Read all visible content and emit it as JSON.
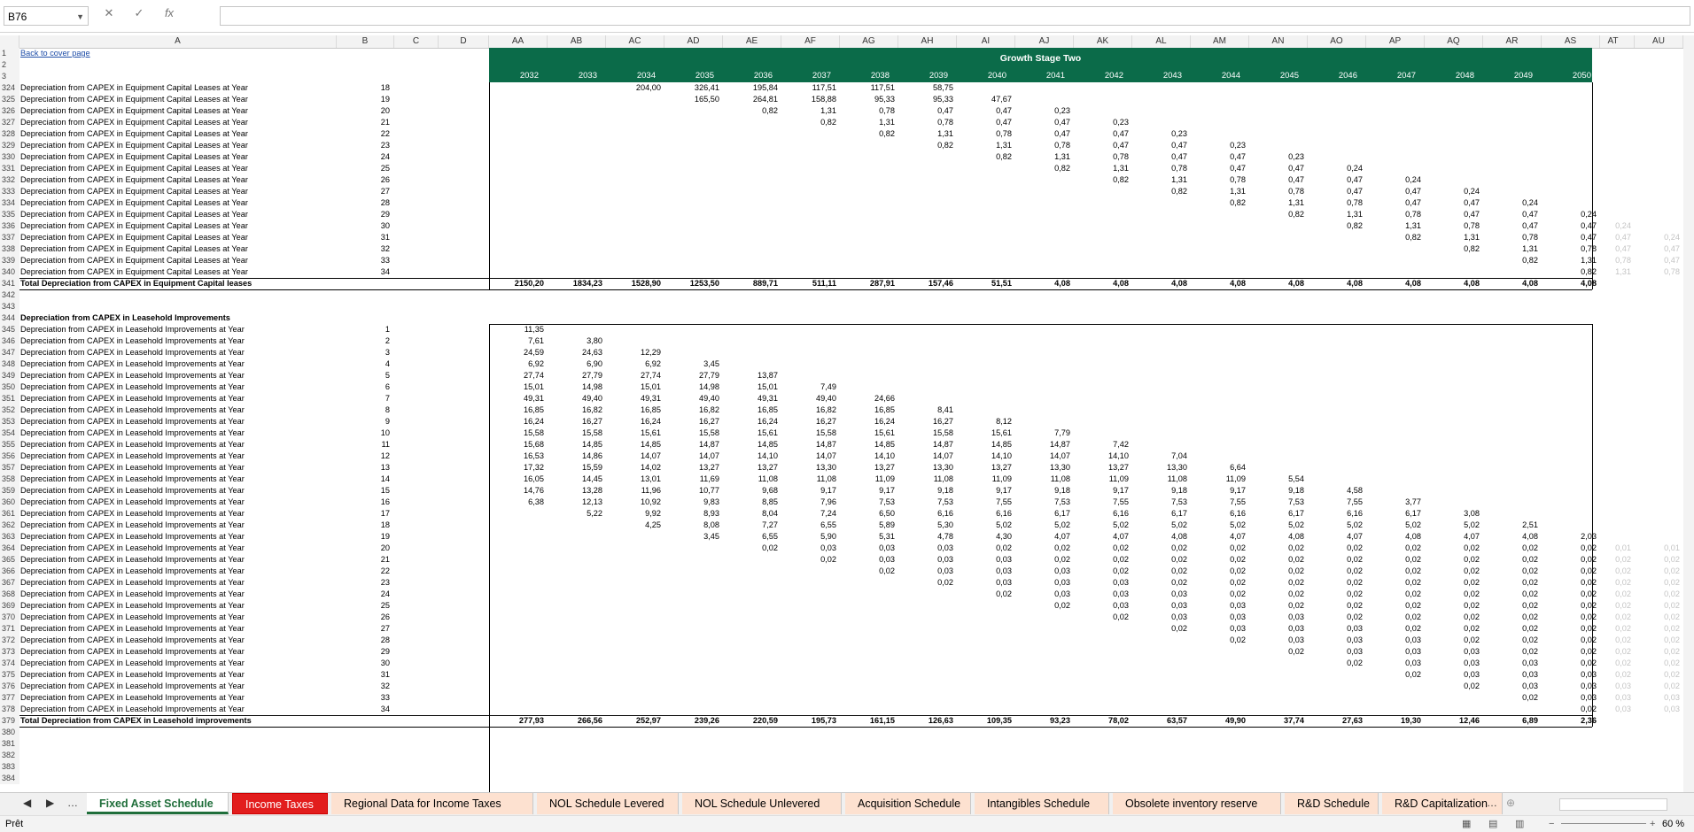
{
  "namebox": {
    "value": "B76"
  },
  "columns": [
    "A",
    "B",
    "C",
    "D",
    "AA",
    "AB",
    "AC",
    "AD",
    "AE",
    "AF",
    "AG",
    "AH",
    "AI",
    "AJ",
    "AK",
    "AL",
    "AM",
    "AN",
    "AO",
    "AP",
    "AQ",
    "AR",
    "AS",
    "AT",
    "AU"
  ],
  "growth_stage_title": "Growth Stage Two",
  "years": [
    "2032",
    "2033",
    "2034",
    "2035",
    "2036",
    "2037",
    "2038",
    "2039",
    "2040",
    "2041",
    "2042",
    "2043",
    "2044",
    "2045",
    "2046",
    "2047",
    "2048",
    "2049",
    "2050"
  ],
  "back_link": "Back to cover page",
  "equip_label": "Depreciation from CAPEX in Equipment Capital Leases at Year",
  "lease_label": "Depreciation from CAPEX in Leasehold Improvements at Year",
  "equip_rows": [
    {
      "r": "324",
      "b": "18",
      "v": {
        "AC": "204,00",
        "AD": "326,41",
        "AE": "195,84",
        "AF": "117,51",
        "AG": "117,51",
        "AH": "58,75"
      }
    },
    {
      "r": "325",
      "b": "19",
      "v": {
        "AD": "165,50",
        "AE": "264,81",
        "AF": "158,88",
        "AG": "95,33",
        "AH": "95,33",
        "AI": "47,67"
      }
    },
    {
      "r": "326",
      "b": "20",
      "v": {
        "AE": "0,82",
        "AF": "1,31",
        "AG": "0,78",
        "AH": "0,47",
        "AI": "0,47",
        "AJ": "0,23"
      }
    },
    {
      "r": "327",
      "b": "21",
      "v": {
        "AF": "0,82",
        "AG": "1,31",
        "AH": "0,78",
        "AI": "0,47",
        "AJ": "0,47",
        "AK": "0,23"
      }
    },
    {
      "r": "328",
      "b": "22",
      "v": {
        "AG": "0,82",
        "AH": "1,31",
        "AI": "0,78",
        "AJ": "0,47",
        "AK": "0,47",
        "AL": "0,23"
      }
    },
    {
      "r": "329",
      "b": "23",
      "v": {
        "AH": "0,82",
        "AI": "1,31",
        "AJ": "0,78",
        "AK": "0,47",
        "AL": "0,47",
        "AM": "0,23"
      }
    },
    {
      "r": "330",
      "b": "24",
      "v": {
        "AI": "0,82",
        "AJ": "1,31",
        "AK": "0,78",
        "AL": "0,47",
        "AM": "0,47",
        "AN": "0,23"
      }
    },
    {
      "r": "331",
      "b": "25",
      "v": {
        "AJ": "0,82",
        "AK": "1,31",
        "AL": "0,78",
        "AM": "0,47",
        "AN": "0,47",
        "AO": "0,24"
      }
    },
    {
      "r": "332",
      "b": "26",
      "v": {
        "AK": "0,82",
        "AL": "1,31",
        "AM": "0,78",
        "AN": "0,47",
        "AO": "0,47",
        "AP": "0,24"
      }
    },
    {
      "r": "333",
      "b": "27",
      "v": {
        "AL": "0,82",
        "AM": "1,31",
        "AN": "0,78",
        "AO": "0,47",
        "AP": "0,47",
        "AQ": "0,24"
      }
    },
    {
      "r": "334",
      "b": "28",
      "v": {
        "AM": "0,82",
        "AN": "1,31",
        "AO": "0,78",
        "AP": "0,47",
        "AQ": "0,47",
        "AR": "0,24"
      }
    },
    {
      "r": "335",
      "b": "29",
      "v": {
        "AN": "0,82",
        "AO": "1,31",
        "AP": "0,78",
        "AQ": "0,47",
        "AR": "0,47",
        "AS": "0,24"
      }
    },
    {
      "r": "336",
      "b": "30",
      "v": {
        "AO": "0,82",
        "AP": "1,31",
        "AQ": "0,78",
        "AR": "0,47",
        "AS": "0,47",
        "AT": "0,24"
      }
    },
    {
      "r": "337",
      "b": "31",
      "v": {
        "AP": "0,82",
        "AQ": "1,31",
        "AR": "0,78",
        "AS": "0,47",
        "AT": "0,47",
        "AU": "0,24"
      }
    },
    {
      "r": "338",
      "b": "32",
      "v": {
        "AQ": "0,82",
        "AR": "1,31",
        "AS": "0,78",
        "AT": "0,47",
        "AU": "0,47"
      }
    },
    {
      "r": "339",
      "b": "33",
      "v": {
        "AR": "0,82",
        "AS": "1,31",
        "AT": "0,78",
        "AU": "0,47"
      }
    },
    {
      "r": "340",
      "b": "34",
      "v": {
        "AS": "0,82",
        "AT": "1,31",
        "AU": "0,78"
      }
    }
  ],
  "equip_total": {
    "r": "341",
    "label": "Total Depreciation from CAPEX in Equipment Capital leases",
    "values": [
      "2150,20",
      "1834,23",
      "1528,90",
      "1253,50",
      "889,71",
      "511,11",
      "287,91",
      "157,46",
      "51,51",
      "4,08",
      "4,08",
      "4,08",
      "4,08",
      "4,08",
      "4,08",
      "4,08",
      "4,08",
      "4,08",
      "4,08"
    ]
  },
  "blank_rows_a": [
    "342",
    "343"
  ],
  "lease_header": {
    "r": "344",
    "label": "Depreciation from CAPEX in Leasehold Improvements"
  },
  "lease_rows": [
    {
      "r": "345",
      "b": "1",
      "v": {
        "AA": "11,35"
      }
    },
    {
      "r": "346",
      "b": "2",
      "v": {
        "AA": "7,61",
        "AB": "3,80"
      }
    },
    {
      "r": "347",
      "b": "3",
      "v": {
        "AA": "24,59",
        "AB": "24,63",
        "AC": "12,29"
      }
    },
    {
      "r": "348",
      "b": "4",
      "v": {
        "AA": "6,92",
        "AB": "6,90",
        "AC": "6,92",
        "AD": "3,45"
      }
    },
    {
      "r": "349",
      "b": "5",
      "v": {
        "AA": "27,74",
        "AB": "27,79",
        "AC": "27,74",
        "AD": "27,79",
        "AE": "13,87"
      }
    },
    {
      "r": "350",
      "b": "6",
      "v": {
        "AA": "15,01",
        "AB": "14,98",
        "AC": "15,01",
        "AD": "14,98",
        "AE": "15,01",
        "AF": "7,49"
      }
    },
    {
      "r": "351",
      "b": "7",
      "v": {
        "AA": "49,31",
        "AB": "49,40",
        "AC": "49,31",
        "AD": "49,40",
        "AE": "49,31",
        "AF": "49,40",
        "AG": "24,66"
      }
    },
    {
      "r": "352",
      "b": "8",
      "v": {
        "AA": "16,85",
        "AB": "16,82",
        "AC": "16,85",
        "AD": "16,82",
        "AE": "16,85",
        "AF": "16,82",
        "AG": "16,85",
        "AH": "8,41"
      }
    },
    {
      "r": "353",
      "b": "9",
      "v": {
        "AA": "16,24",
        "AB": "16,27",
        "AC": "16,24",
        "AD": "16,27",
        "AE": "16,24",
        "AF": "16,27",
        "AG": "16,24",
        "AH": "16,27",
        "AI": "8,12"
      }
    },
    {
      "r": "354",
      "b": "10",
      "v": {
        "AA": "15,58",
        "AB": "15,58",
        "AC": "15,61",
        "AD": "15,58",
        "AE": "15,61",
        "AF": "15,58",
        "AG": "15,61",
        "AH": "15,58",
        "AI": "15,61",
        "AJ": "7,79"
      }
    },
    {
      "r": "355",
      "b": "11",
      "v": {
        "AA": "15,68",
        "AB": "14,85",
        "AC": "14,85",
        "AD": "14,87",
        "AE": "14,85",
        "AF": "14,87",
        "AG": "14,85",
        "AH": "14,87",
        "AI": "14,85",
        "AJ": "14,87",
        "AK": "7,42"
      }
    },
    {
      "r": "356",
      "b": "12",
      "v": {
        "AA": "16,53",
        "AB": "14,86",
        "AC": "14,07",
        "AD": "14,07",
        "AE": "14,10",
        "AF": "14,07",
        "AG": "14,10",
        "AH": "14,07",
        "AI": "14,10",
        "AJ": "14,07",
        "AK": "14,10",
        "AL": "7,04"
      }
    },
    {
      "r": "357",
      "b": "13",
      "v": {
        "AA": "17,32",
        "AB": "15,59",
        "AC": "14,02",
        "AD": "13,27",
        "AE": "13,27",
        "AF": "13,30",
        "AG": "13,27",
        "AH": "13,30",
        "AI": "13,27",
        "AJ": "13,30",
        "AK": "13,27",
        "AL": "13,30",
        "AM": "6,64"
      }
    },
    {
      "r": "358",
      "b": "14",
      "v": {
        "AA": "16,05",
        "AB": "14,45",
        "AC": "13,01",
        "AD": "11,69",
        "AE": "11,08",
        "AF": "11,08",
        "AG": "11,09",
        "AH": "11,08",
        "AI": "11,09",
        "AJ": "11,08",
        "AK": "11,09",
        "AL": "11,08",
        "AM": "11,09",
        "AN": "5,54"
      }
    },
    {
      "r": "359",
      "b": "15",
      "v": {
        "AA": "14,76",
        "AB": "13,28",
        "AC": "11,96",
        "AD": "10,77",
        "AE": "9,68",
        "AF": "9,17",
        "AG": "9,17",
        "AH": "9,18",
        "AI": "9,17",
        "AJ": "9,18",
        "AK": "9,17",
        "AL": "9,18",
        "AM": "9,17",
        "AN": "9,18",
        "AO": "4,58"
      }
    },
    {
      "r": "360",
      "b": "16",
      "v": {
        "AA": "6,38",
        "AB": "12,13",
        "AC": "10,92",
        "AD": "9,83",
        "AE": "8,85",
        "AF": "7,96",
        "AG": "7,53",
        "AH": "7,53",
        "AI": "7,55",
        "AJ": "7,53",
        "AK": "7,55",
        "AL": "7,53",
        "AM": "7,55",
        "AN": "7,53",
        "AO": "7,55",
        "AP": "3,77"
      }
    },
    {
      "r": "361",
      "b": "17",
      "v": {
        "AB": "5,22",
        "AC": "9,92",
        "AD": "8,93",
        "AE": "8,04",
        "AF": "7,24",
        "AG": "6,50",
        "AH": "6,16",
        "AI": "6,16",
        "AJ": "6,17",
        "AK": "6,16",
        "AL": "6,17",
        "AM": "6,16",
        "AN": "6,17",
        "AO": "6,16",
        "AP": "6,17",
        "AQ": "3,08"
      }
    },
    {
      "r": "362",
      "b": "18",
      "v": {
        "AC": "4,25",
        "AD": "8,08",
        "AE": "7,27",
        "AF": "6,55",
        "AG": "5,89",
        "AH": "5,30",
        "AI": "5,02",
        "AJ": "5,02",
        "AK": "5,02",
        "AL": "5,02",
        "AM": "5,02",
        "AN": "5,02",
        "AO": "5,02",
        "AP": "5,02",
        "AQ": "5,02",
        "AR": "2,51"
      }
    },
    {
      "r": "363",
      "b": "19",
      "v": {
        "AD": "3,45",
        "AE": "6,55",
        "AF": "5,90",
        "AG": "5,31",
        "AH": "4,78",
        "AI": "4,30",
        "AJ": "4,07",
        "AK": "4,07",
        "AL": "4,08",
        "AM": "4,07",
        "AN": "4,08",
        "AO": "4,07",
        "AP": "4,08",
        "AQ": "4,07",
        "AR": "4,08",
        "AS": "2,03"
      }
    },
    {
      "r": "364",
      "b": "20",
      "v": {
        "AE": "0,02",
        "AF": "0,03",
        "AG": "0,03",
        "AH": "0,03",
        "AI": "0,02",
        "AJ": "0,02",
        "AK": "0,02",
        "AL": "0,02",
        "AM": "0,02",
        "AN": "0,02",
        "AO": "0,02",
        "AP": "0,02",
        "AQ": "0,02",
        "AR": "0,02",
        "AS": "0,02",
        "AT": "0,01",
        "AU": "0,01"
      }
    },
    {
      "r": "365",
      "b": "21",
      "v": {
        "AF": "0,02",
        "AG": "0,03",
        "AH": "0,03",
        "AI": "0,03",
        "AJ": "0,02",
        "AK": "0,02",
        "AL": "0,02",
        "AM": "0,02",
        "AN": "0,02",
        "AO": "0,02",
        "AP": "0,02",
        "AQ": "0,02",
        "AR": "0,02",
        "AS": "0,02",
        "AT": "0,02",
        "AU": "0,02"
      }
    },
    {
      "r": "366",
      "b": "22",
      "v": {
        "AG": "0,02",
        "AH": "0,03",
        "AI": "0,03",
        "AJ": "0,03",
        "AK": "0,02",
        "AL": "0,02",
        "AM": "0,02",
        "AN": "0,02",
        "AO": "0,02",
        "AP": "0,02",
        "AQ": "0,02",
        "AR": "0,02",
        "AS": "0,02",
        "AT": "0,02",
        "AU": "0,02"
      }
    },
    {
      "r": "367",
      "b": "23",
      "v": {
        "AH": "0,02",
        "AI": "0,03",
        "AJ": "0,03",
        "AK": "0,03",
        "AL": "0,02",
        "AM": "0,02",
        "AN": "0,02",
        "AO": "0,02",
        "AP": "0,02",
        "AQ": "0,02",
        "AR": "0,02",
        "AS": "0,02",
        "AT": "0,02",
        "AU": "0,02"
      }
    },
    {
      "r": "368",
      "b": "24",
      "v": {
        "AI": "0,02",
        "AJ": "0,03",
        "AK": "0,03",
        "AL": "0,03",
        "AM": "0,02",
        "AN": "0,02",
        "AO": "0,02",
        "AP": "0,02",
        "AQ": "0,02",
        "AR": "0,02",
        "AS": "0,02",
        "AT": "0,02",
        "AU": "0,02"
      }
    },
    {
      "r": "369",
      "b": "25",
      "v": {
        "AJ": "0,02",
        "AK": "0,03",
        "AL": "0,03",
        "AM": "0,03",
        "AN": "0,02",
        "AO": "0,02",
        "AP": "0,02",
        "AQ": "0,02",
        "AR": "0,02",
        "AS": "0,02",
        "AT": "0,02",
        "AU": "0,02"
      }
    },
    {
      "r": "370",
      "b": "26",
      "v": {
        "AK": "0,02",
        "AL": "0,03",
        "AM": "0,03",
        "AN": "0,03",
        "AO": "0,02",
        "AP": "0,02",
        "AQ": "0,02",
        "AR": "0,02",
        "AS": "0,02",
        "AT": "0,02",
        "AU": "0,02"
      }
    },
    {
      "r": "371",
      "b": "27",
      "v": {
        "AL": "0,02",
        "AM": "0,03",
        "AN": "0,03",
        "AO": "0,03",
        "AP": "0,02",
        "AQ": "0,02",
        "AR": "0,02",
        "AS": "0,02",
        "AT": "0,02",
        "AU": "0,02"
      }
    },
    {
      "r": "372",
      "b": "28",
      "v": {
        "AM": "0,02",
        "AN": "0,03",
        "AO": "0,03",
        "AP": "0,03",
        "AQ": "0,02",
        "AR": "0,02",
        "AS": "0,02",
        "AT": "0,02",
        "AU": "0,02"
      }
    },
    {
      "r": "373",
      "b": "29",
      "v": {
        "AN": "0,02",
        "AO": "0,03",
        "AP": "0,03",
        "AQ": "0,03",
        "AR": "0,02",
        "AS": "0,02",
        "AT": "0,02",
        "AU": "0,02"
      }
    },
    {
      "r": "374",
      "b": "30",
      "v": {
        "AO": "0,02",
        "AP": "0,03",
        "AQ": "0,03",
        "AR": "0,03",
        "AS": "0,02",
        "AT": "0,02",
        "AU": "0,02"
      }
    },
    {
      "r": "375",
      "b": "31",
      "v": {
        "AP": "0,02",
        "AQ": "0,03",
        "AR": "0,03",
        "AS": "0,03",
        "AT": "0,02",
        "AU": "0,02"
      }
    },
    {
      "r": "376",
      "b": "32",
      "v": {
        "AQ": "0,02",
        "AR": "0,03",
        "AS": "0,03",
        "AT": "0,03",
        "AU": "0,02"
      }
    },
    {
      "r": "377",
      "b": "33",
      "v": {
        "AR": "0,02",
        "AS": "0,03",
        "AT": "0,03",
        "AU": "0,03"
      }
    },
    {
      "r": "378",
      "b": "34",
      "v": {
        "AS": "0,02",
        "AT": "0,03",
        "AU": "0,03"
      }
    }
  ],
  "lease_total": {
    "r": "379",
    "label": "Total Depreciation from CAPEX in Leasehold improvements",
    "values": [
      "277,93",
      "266,56",
      "252,97",
      "239,26",
      "220,59",
      "195,73",
      "161,15",
      "126,63",
      "109,35",
      "93,23",
      "78,02",
      "63,57",
      "49,90",
      "37,74",
      "27,63",
      "19,30",
      "12,46",
      "6,89",
      "2,36"
    ]
  },
  "blank_rows_b": [
    "380",
    "381",
    "382",
    "383",
    "384"
  ],
  "tabs": [
    {
      "label": "Fixed Asset Schedule",
      "style": "active"
    },
    {
      "label": "Income Taxes",
      "style": "red"
    },
    {
      "label": "Regional Data for Income Taxes",
      "style": "orange"
    },
    {
      "label": "NOL Schedule Levered",
      "style": "orange"
    },
    {
      "label": "NOL Schedule Unlevered",
      "style": "orange"
    },
    {
      "label": "Acquisition Schedule",
      "style": "orange"
    },
    {
      "label": "Intangibles Schedule",
      "style": "orange"
    },
    {
      "label": "Obsolete inventory reserve",
      "style": "orange"
    },
    {
      "label": "R&D Schedule",
      "style": "orange"
    },
    {
      "label": "R&D Capitalization",
      "style": "orange"
    }
  ],
  "status": {
    "mode": "Prêt",
    "zoom": "60 %"
  }
}
